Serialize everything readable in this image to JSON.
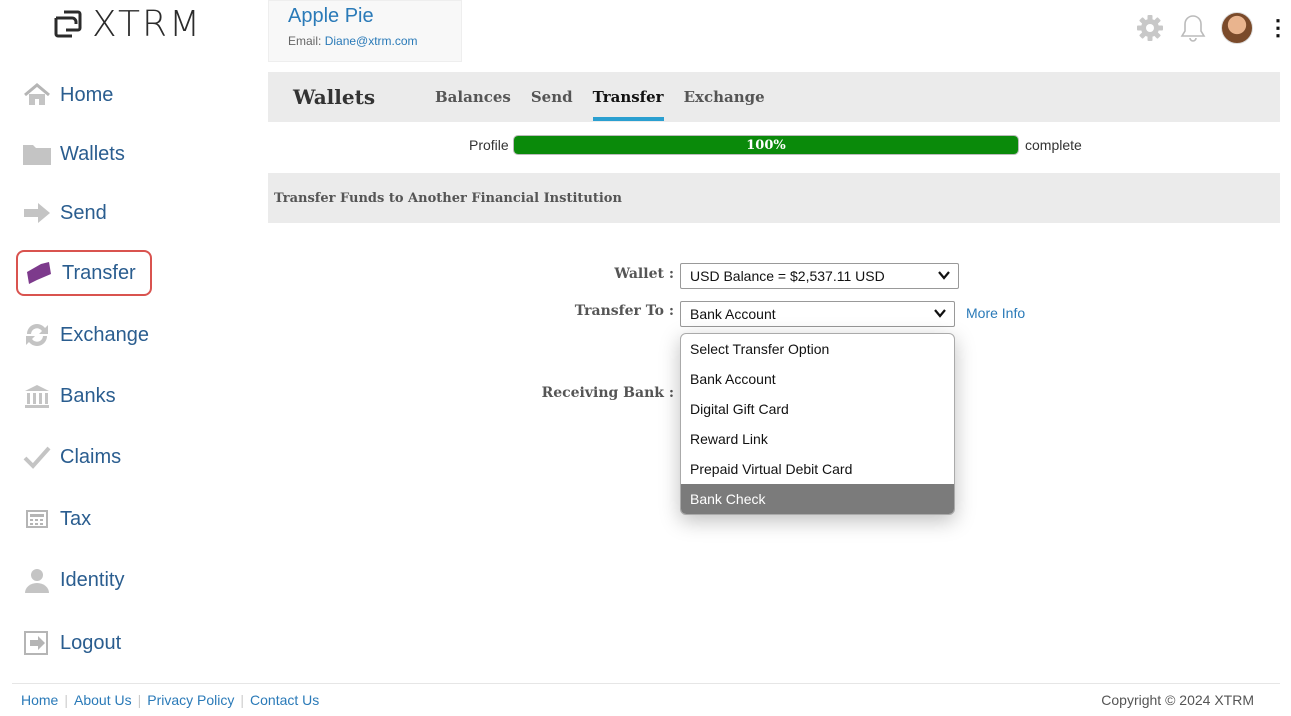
{
  "brand": {
    "name": "XTRM"
  },
  "user": {
    "name": "Apple Pie",
    "email_label": "Email:",
    "email": "Diane@xtrm.com"
  },
  "sidebar": {
    "items": [
      {
        "label": "Home",
        "icon": "home-icon"
      },
      {
        "label": "Wallets",
        "icon": "folder-icon"
      },
      {
        "label": "Send",
        "icon": "arrow-right-icon"
      },
      {
        "label": "Transfer",
        "icon": "transfer-icon",
        "active": true
      },
      {
        "label": "Exchange",
        "icon": "exchange-icon"
      },
      {
        "label": "Banks",
        "icon": "bank-icon"
      },
      {
        "label": "Claims",
        "icon": "check-icon"
      },
      {
        "label": "Tax",
        "icon": "calculator-icon"
      },
      {
        "label": "Identity",
        "icon": "person-icon"
      },
      {
        "label": "Logout",
        "icon": "logout-icon"
      }
    ]
  },
  "tabs": {
    "title": "Wallets",
    "items": [
      {
        "label": "Balances"
      },
      {
        "label": "Send"
      },
      {
        "label": "Transfer",
        "active": true
      },
      {
        "label": "Exchange"
      }
    ]
  },
  "profile": {
    "label": "Profile",
    "percent_text": "100%",
    "progress": 1.0,
    "suffix": "complete"
  },
  "section": {
    "title": "Transfer Funds to Another Financial Institution"
  },
  "form": {
    "wallet_label": "Wallet :",
    "wallet_value": "USD Balance = $2,537.11 USD",
    "transfer_to_label": "Transfer To :",
    "transfer_to_value": "Bank Account",
    "more_info": "More Info",
    "receiving_bank_label": "Receiving Bank :"
  },
  "dropdown": {
    "options": [
      {
        "label": "Select Transfer Option"
      },
      {
        "label": "Bank Account"
      },
      {
        "label": "Digital Gift Card"
      },
      {
        "label": "Reward Link"
      },
      {
        "label": "Prepaid Virtual Debit Card"
      },
      {
        "label": "Bank Check",
        "highlighted": true
      }
    ]
  },
  "footer": {
    "links": [
      "Home",
      "About Us",
      "Privacy Policy",
      "Contact Us"
    ],
    "copyright": "Copyright © 2024 XTRM"
  },
  "colors": {
    "link": "#2a7ab8",
    "progress": "#0a8a0a",
    "active_border": "#d9534f",
    "tab_underline": "#2a9fd0"
  }
}
